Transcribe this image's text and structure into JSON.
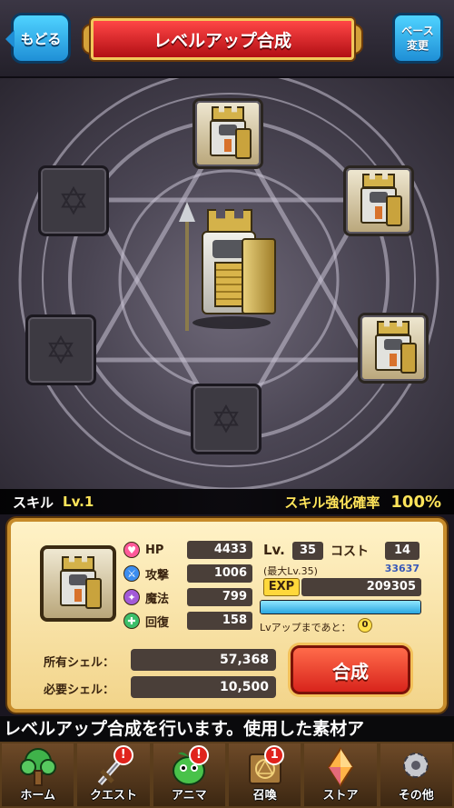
{
  "header": {
    "back_label": "もどる",
    "title": "レベルアップ合成",
    "base_change_label_line1": "ベース",
    "base_change_label_line2": "変更"
  },
  "skill": {
    "label": "スキル",
    "level": "Lv.1",
    "rate_label": "スキル強化確率",
    "rate_value": "100%"
  },
  "stats": {
    "hp_label": "HP",
    "hp_value": "4433",
    "attack_label": "攻撃",
    "attack_value": "1006",
    "magic_label": "魔法",
    "magic_value": "799",
    "recovery_label": "回復",
    "recovery_value": "158",
    "lv_label": "Lv.",
    "lv_value": "35",
    "cost_label": "コスト",
    "cost_value": "14",
    "max_lv": "(最大Lv.35)",
    "exp_small": "33637",
    "exp_label": "EXP",
    "exp_value": "209305",
    "exp_progress": 1.0,
    "lvup_label": "Lvアップまであと：",
    "lvup_value": "0",
    "owned_shell_label": "所有シェル：",
    "owned_shell_value": "57,368",
    "required_shell_label": "必要シェル：",
    "required_shell_value": "10,500",
    "fuse_label": "合成"
  },
  "ticker": {
    "text": "レベルアップ合成を行います。使用した素材ア"
  },
  "nav": {
    "items": [
      {
        "label": "ホーム",
        "icon": "tree-icon",
        "badge": ""
      },
      {
        "label": "クエスト",
        "icon": "sword-icon",
        "badge": "!"
      },
      {
        "label": "アニマ",
        "icon": "plant-creature-icon",
        "badge": "!"
      },
      {
        "label": "召喚",
        "icon": "spellbook-icon",
        "badge": "1"
      },
      {
        "label": "ストア",
        "icon": "crystal-icon",
        "badge": ""
      },
      {
        "label": "その他",
        "icon": "gear-icon",
        "badge": ""
      }
    ]
  },
  "colors": {
    "title_banner": "#d8242a",
    "button_blue": "#2aa7e0",
    "fuse_button": "#e0321f",
    "panel_bg": "#f7e2a6",
    "highlight_yellow": "#ffe45a"
  }
}
